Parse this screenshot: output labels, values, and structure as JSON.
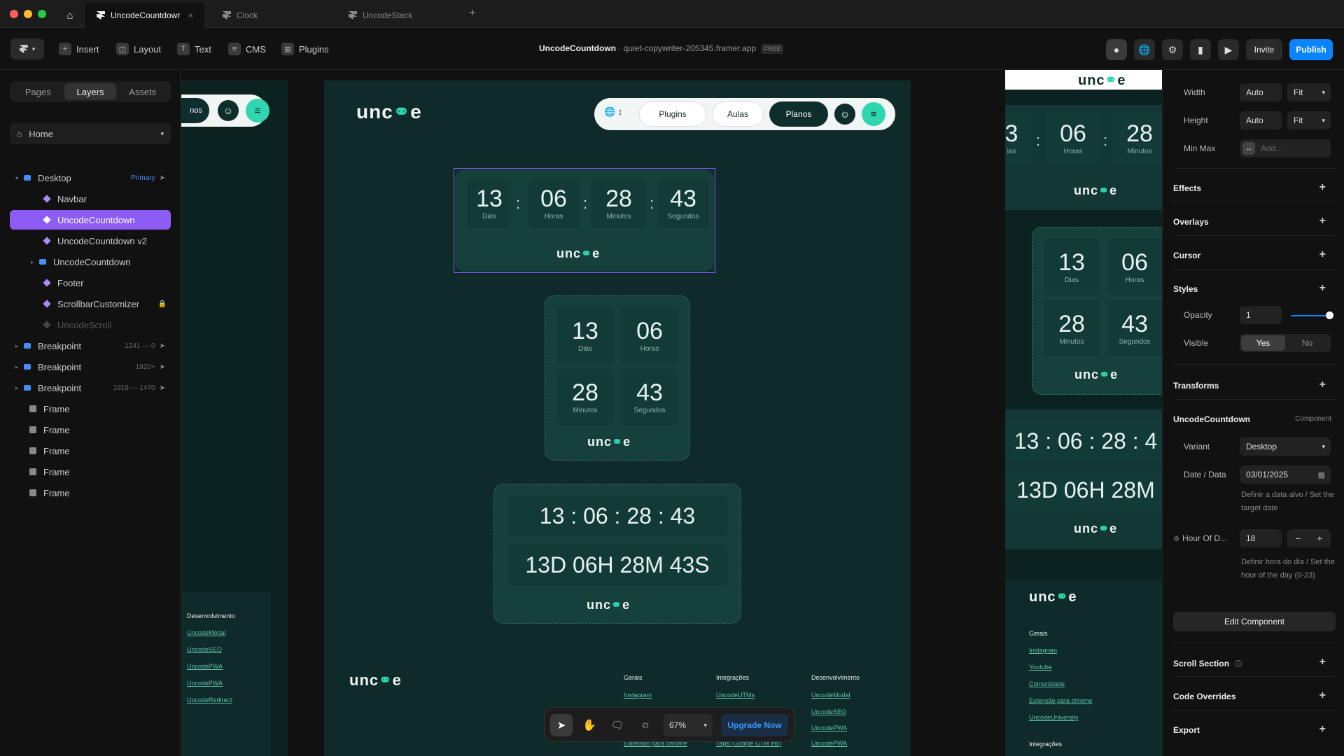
{
  "tabs": [
    {
      "label": "UncodeCountdowr"
    },
    {
      "label": "Clock"
    },
    {
      "label": "UncodeStack"
    }
  ],
  "toolbar": {
    "insert": "Insert",
    "layout": "Layout",
    "text": "Text",
    "cms": "CMS",
    "plugins": "Plugins",
    "project_name": "UncodeCountdown",
    "project_url": "quiet-copywriter-205345.framer.app",
    "plan_badge": "FREE",
    "invite": "Invite",
    "publish": "Publish"
  },
  "left": {
    "tabs": [
      "Pages",
      "Layers",
      "Assets"
    ],
    "page": "Home",
    "layers": [
      {
        "label": "Desktop",
        "meta": "Primary"
      },
      {
        "label": "Navbar",
        "meta": ""
      },
      {
        "label": "UncodeCountdown",
        "meta": ""
      },
      {
        "label": "UncodeCountdown v2",
        "meta": ""
      },
      {
        "label": "UncodeCountdown",
        "meta": ""
      },
      {
        "label": "Footer",
        "meta": ""
      },
      {
        "label": "ScrollbarCustomizer",
        "meta": ""
      },
      {
        "label": "UncodeScroll",
        "meta": ""
      },
      {
        "label": "Breakpoint",
        "meta": "1241 — 0"
      },
      {
        "label": "Breakpoint",
        "meta": "1920+"
      },
      {
        "label": "Breakpoint",
        "meta": "1919 — 1470"
      },
      {
        "label": "Frame",
        "meta": ""
      },
      {
        "label": "Frame",
        "meta": ""
      },
      {
        "label": "Frame",
        "meta": ""
      },
      {
        "label": "Frame",
        "meta": ""
      },
      {
        "label": "Frame",
        "meta": ""
      }
    ]
  },
  "site": {
    "logo": "unc",
    "logo_end": "e",
    "nav": {
      "plugins": "Plugins",
      "aulas": "Aulas",
      "planos": "Planos",
      "planos_partial": "nos"
    },
    "countdown": {
      "days": "13",
      "hours": "06",
      "minutes": "28",
      "seconds": "43",
      "days_label": "Dias",
      "hours_label": "Horas",
      "minutes_label": "Minutos",
      "seconds_label": "Segundos",
      "clock_line": "13 : 06 : 28 : 43",
      "long_line": "13D 06H 28M 43S",
      "right_clock": "13 : 06 : 28 : 4",
      "right_long": "13D 06H 28M",
      "right_days_partial": "3",
      "right_days_label_partial": "ias"
    },
    "footer": {
      "gerais": "Gerais",
      "integracoes": "Integrações",
      "desenvolvimento": "Desenvolvimento",
      "instagram": "Instagram",
      "youtube": "Youtube",
      "comunidade": "Comunidade",
      "extensao": "Extensão para chrome",
      "university": "UncodeUniversity",
      "utms": "UncodeUTMs",
      "tags": "Tags (Google GTM etc)",
      "modal": "UncodeModal",
      "seo": "UncodeSEO",
      "pwa": "UncodePWA",
      "pwa2": "UncodePWA",
      "redirect": "UncodeRedirect"
    }
  },
  "bottombar": {
    "zoom": "67%",
    "upgrade": "Upgrade Now"
  },
  "right": {
    "width_label": "Width",
    "width_value": "Auto",
    "width_mode": "Fit",
    "height_label": "Height",
    "height_value": "Auto",
    "height_mode": "Fit",
    "minmax_label": "Min Max",
    "minmax_placeholder": "Add...",
    "effects": "Effects",
    "overlays": "Overlays",
    "cursor": "Cursor",
    "styles": "Styles",
    "opacity_label": "Opacity",
    "opacity_value": "1",
    "opacity_level": 1,
    "visible_label": "Visible",
    "visible_yes": "Yes",
    "visible_no": "No",
    "transforms": "Transforms",
    "component_name": "UncodeCountdown",
    "component_tag": "Component",
    "variant_label": "Variant",
    "variant_value": "Desktop",
    "date_label": "Date / Data",
    "date_value": "03/01/2025",
    "date_hint": "Definir a data alvo / Set the target date",
    "hour_label": "Hour Of D...",
    "hour_value": "18",
    "hour_hint": "Definir hora do dia / Set the hour of the day (0-23)",
    "edit_component": "Edit Component",
    "scroll_section": "Scroll Section",
    "code_overrides": "Code Overrides",
    "export": "Export"
  },
  "colors": {
    "accent": "#8c5cf5",
    "publish": "#0a84ff",
    "site_bg": "#0e2a29",
    "teal": "#2fd6b0"
  }
}
